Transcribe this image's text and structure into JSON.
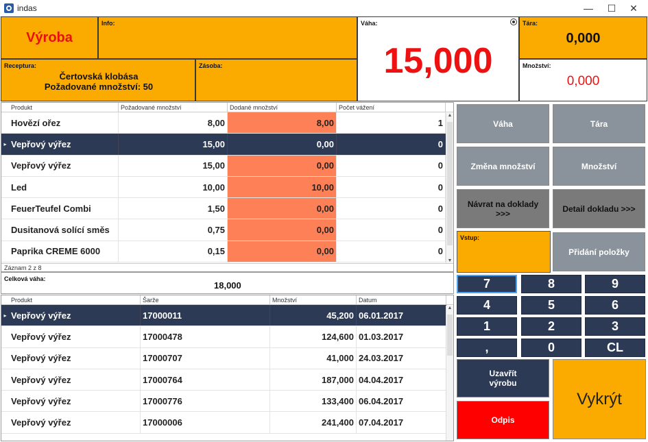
{
  "window": {
    "title": "indas",
    "min": "—",
    "max": "☐",
    "close": "✕"
  },
  "header": {
    "mode": "Výroba",
    "info_label": "Info:",
    "vaha_label": "Váha:",
    "vaha_value": "15,000",
    "tara_label": "Tára:",
    "tara_value": "0,000",
    "mnozstvi_label": "Množství:",
    "mnozstvi_value": "0,000",
    "receptura_label": "Receptura:",
    "receptura_name": "Čertovská klobása",
    "receptura_qty": "Požadované množství: 50",
    "zasoba_label": "Zásoba:"
  },
  "grid1": {
    "columns": [
      "Produkt",
      "Požadované množství",
      "Dodané množství",
      "Počet vážení"
    ],
    "rows": [
      {
        "produkt": "Hovězí ořez",
        "pozad": "8,00",
        "dod": "8,00",
        "pocet": "1",
        "selected": false
      },
      {
        "produkt": "Vepřový výřez",
        "pozad": "15,00",
        "dod": "0,00",
        "pocet": "0",
        "selected": true
      },
      {
        "produkt": "Vepřový výřez",
        "pozad": "15,00",
        "dod": "0,00",
        "pocet": "0",
        "selected": false
      },
      {
        "produkt": "Led",
        "pozad": "10,00",
        "dod": "10,00",
        "pocet": "0",
        "selected": false
      },
      {
        "produkt": "FeuerTeufel Combi",
        "pozad": "1,50",
        "dod": "0,00",
        "pocet": "0",
        "selected": false
      },
      {
        "produkt": "Dusitanová solící směs",
        "pozad": "0,75",
        "dod": "0,00",
        "pocet": "0",
        "selected": false
      },
      {
        "produkt": "Paprika CREME 6000",
        "pozad": "0,15",
        "dod": "0,00",
        "pocet": "0",
        "selected": false
      }
    ],
    "footer": "Záznam 2 z 8"
  },
  "total": {
    "label": "Celková váha:",
    "value": "18,000"
  },
  "grid2": {
    "columns": [
      "Produkt",
      "Šarže",
      "Množství",
      "Datum"
    ],
    "rows": [
      {
        "produkt": "Vepřový výřez",
        "sarze": "17000011",
        "mnozstvi": "45,200",
        "datum": "06.01.2017",
        "selected": true
      },
      {
        "produkt": "Vepřový výřez",
        "sarze": "17000478",
        "mnozstvi": "124,600",
        "datum": "01.03.2017",
        "selected": false
      },
      {
        "produkt": "Vepřový výřez",
        "sarze": "17000707",
        "mnozstvi": "41,000",
        "datum": "24.03.2017",
        "selected": false
      },
      {
        "produkt": "Vepřový výřez",
        "sarze": "17000764",
        "mnozstvi": "187,000",
        "datum": "04.04.2017",
        "selected": false
      },
      {
        "produkt": "Vepřový výřez",
        "sarze": "17000776",
        "mnozstvi": "133,400",
        "datum": "06.04.2017",
        "selected": false
      },
      {
        "produkt": "Vepřový výřez",
        "sarze": "17000006",
        "mnozstvi": "241,400",
        "datum": "07.04.2017",
        "selected": false
      }
    ]
  },
  "buttons": {
    "vaha": "Váha",
    "tara": "Tára",
    "zmena": "Změna množství",
    "mnozstvi": "Množství",
    "navrat": "Návrat na doklady >>>",
    "detail": "Detail dokladu >>>",
    "vstup_label": "Vstup:",
    "pridani": "Přidání položky",
    "uzavrit": "Uzavřít výrobu",
    "odpis": "Odpis",
    "vykryt": "Vykrýt"
  },
  "numpad": [
    "7",
    "8",
    "9",
    "4",
    "5",
    "6",
    "1",
    "2",
    "3",
    ",",
    "0",
    "CL"
  ]
}
